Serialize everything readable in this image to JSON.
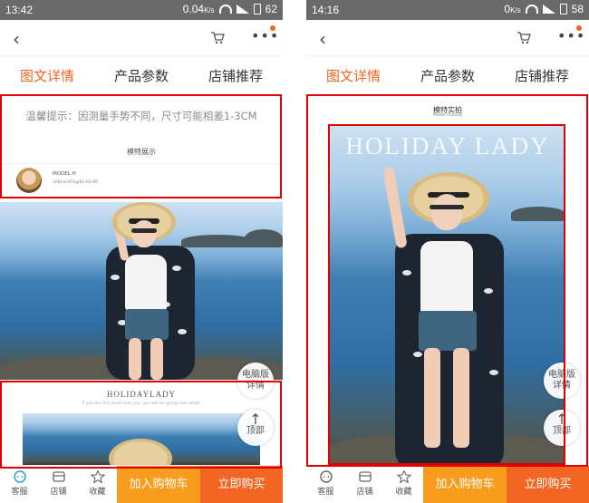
{
  "screens": [
    {
      "status": {
        "time": "13:42",
        "data_rate": "0.04",
        "battery": "62"
      },
      "tabs": [
        "图文详情",
        "产品参数",
        "店铺推荐"
      ],
      "active_tab": 0,
      "tip": "温馨提示：因测量手势不同，尺寸可能相差1-3CM",
      "model_label": "模特展示",
      "model_name": "MODEL H",
      "model_info": "168cm/45kg/82-60-86",
      "promo_title": "HOLIDAYLADY",
      "promo_subtitle": "If you are this most love you, you will be going next week.",
      "float_pc_line1": "电脑版",
      "float_pc_line2": "详情",
      "float_top_label": "顶部",
      "bottom": {
        "service": "客服",
        "store": "店铺",
        "favorite": "收藏",
        "add_cart": "加入购物车",
        "buy_now": "立即购买"
      }
    },
    {
      "status": {
        "time": "14:16",
        "data_rate": "0",
        "battery": "58"
      },
      "tabs": [
        "图文详情",
        "产品参数",
        "店铺推荐"
      ],
      "active_tab": 0,
      "photo_title": "模特实拍",
      "photo_subtitle": "Model making",
      "overlay_text": "HOLIDAY LADY",
      "float_pc_line1": "电脑版",
      "float_pc_line2": "详情",
      "float_top_label": "顶部",
      "bottom": {
        "service": "客服",
        "store": "店铺",
        "favorite": "收藏",
        "add_cart": "加入购物车",
        "buy_now": "立即购买"
      }
    }
  ],
  "colors": {
    "accent": "#f26522",
    "cart": "#f89c1e",
    "highlight_box": "#e00000"
  }
}
